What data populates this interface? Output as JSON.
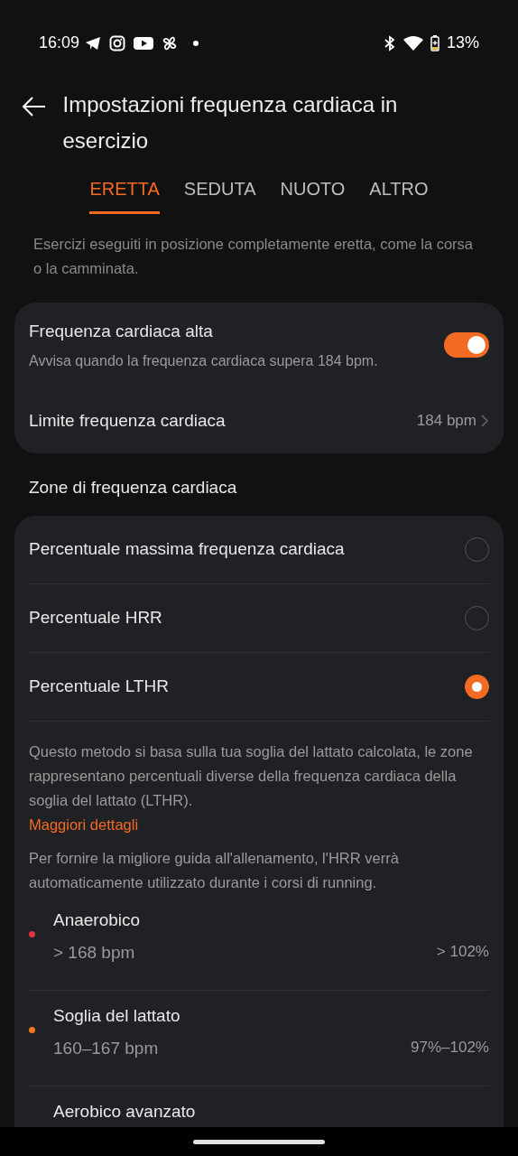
{
  "status_bar": {
    "time": "16:09",
    "battery": "13%"
  },
  "header": {
    "title": "Impostazioni frequenza cardiaca in esercizio"
  },
  "tabs": [
    {
      "label": "ERETTA",
      "selected": true
    },
    {
      "label": "SEDUTA",
      "selected": false
    },
    {
      "label": "NUOTO",
      "selected": false
    },
    {
      "label": "ALTRO",
      "selected": false
    }
  ],
  "description": "Esercizi eseguiti in posizione completamente eretta, come la corsa o la camminata.",
  "alert_card": {
    "title": "Frequenza cardiaca alta",
    "subtitle": "Avvisa quando la frequenza cardiaca supera 184 bpm.",
    "on": true,
    "limit_label": "Limite frequenza cardiaca",
    "limit_value": "184 bpm"
  },
  "zones_section": {
    "title": "Zone di frequenza cardiaca",
    "methods": [
      {
        "label": "Percentuale massima frequenza cardiaca",
        "selected": false
      },
      {
        "label": "Percentuale HRR",
        "selected": false
      },
      {
        "label": "Percentuale LTHR",
        "selected": true
      }
    ],
    "explanation": "Questo metodo si basa sulla tua soglia del lattato calcolata, le zone rappresentano percentuali diverse della frequenza cardiaca della soglia del lattato (LTHR).",
    "link": "Maggiori dettagli",
    "note": "Per fornire la migliore guida all'allenamento, l'HRR verrà automaticamente utilizzato durante i corsi di running.",
    "zones": [
      {
        "name": "Anaerobico",
        "range": "> 168 bpm",
        "percent": "> 102%",
        "color": "#e8323c"
      },
      {
        "name": "Soglia del lattato",
        "range": "160–167 bpm",
        "percent": "97%–102%",
        "color": "#f57a1f"
      },
      {
        "name": "Aerobico avanzato"
      }
    ]
  }
}
